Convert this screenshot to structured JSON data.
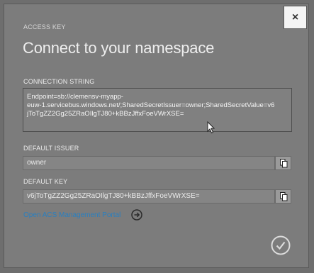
{
  "dialog": {
    "header_label": "ACCESS KEY",
    "title": "Connect to your namespace",
    "close_glyph": "×"
  },
  "connection_string": {
    "label": "CONNECTION STRING",
    "value_lines": [
      "Endpoint=sb://clemensv-myapp-",
      "euw-1.servicebus.windows.net/;SharedSecretIssuer=owner;SharedSecretValue=v6",
      "jToTgZZ2Gg25ZRaOIlgTJ80+kBBzJffxFoeVWrXSE="
    ]
  },
  "default_issuer": {
    "label": "DEFAULT ISSUER",
    "value": "owner"
  },
  "default_key": {
    "label": "DEFAULT KEY",
    "value": "v6jToTgZZ2Gg25ZRaOIlgTJ80+kBBzJffxFoeVWrXSE="
  },
  "links": {
    "acs_portal": "Open ACS Management Portal"
  },
  "icons": {
    "close": "close-icon",
    "copy": "copy-icon",
    "arrow": "arrow-right-circle-icon",
    "ok": "checkmark-circle-icon",
    "cursor": "mouse-cursor-icon"
  },
  "colors": {
    "link": "#2a7fbf",
    "overlay": "#7c7c7c"
  }
}
